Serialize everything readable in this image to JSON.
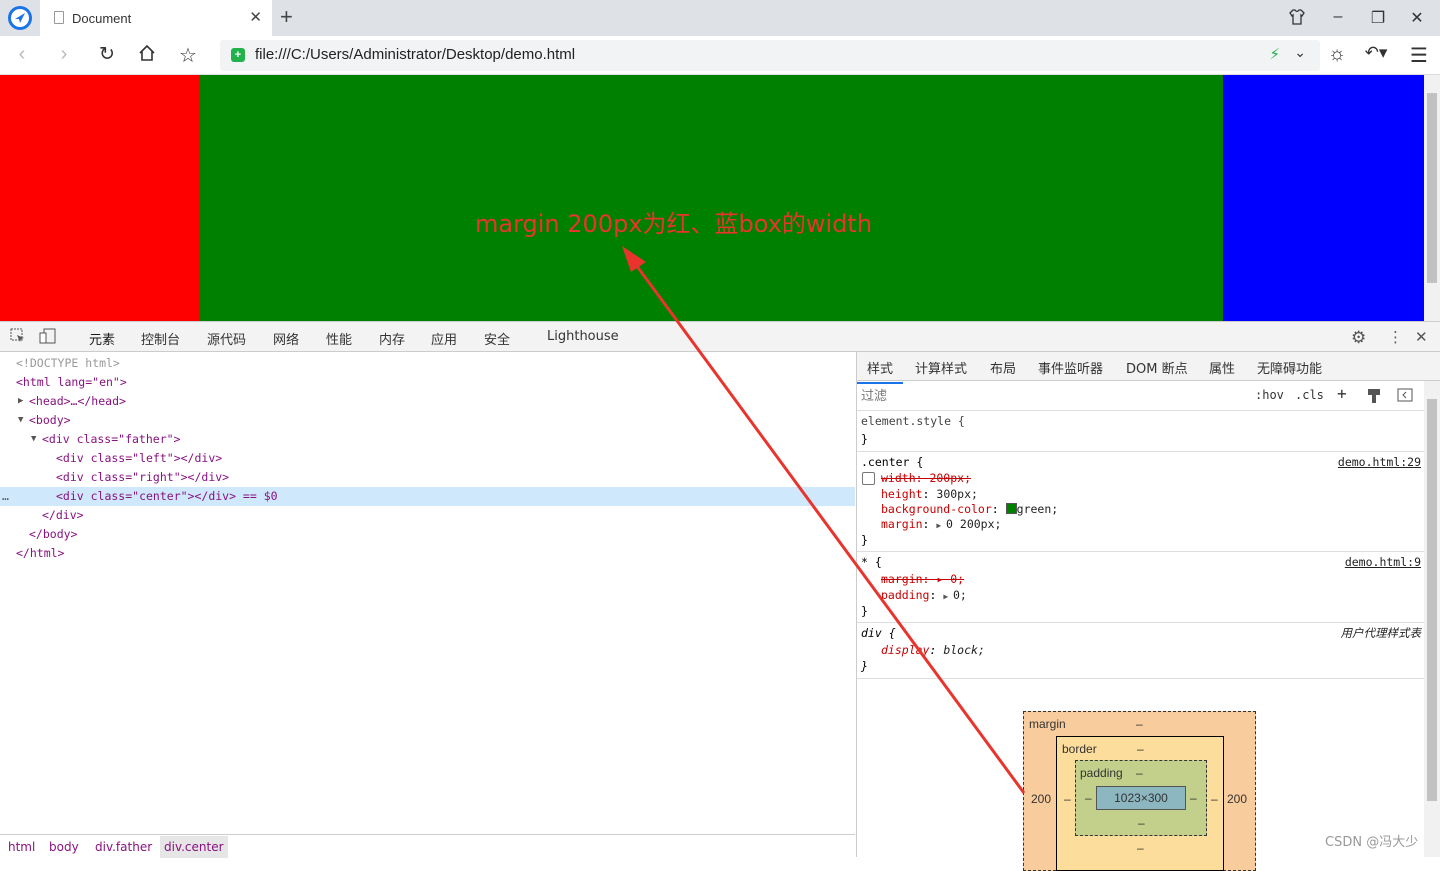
{
  "browser": {
    "tab_title": "Document",
    "tab_close": "✕",
    "new_tab": "+",
    "url": "file:///C:/Users/Administrator/Desktop/demo.html"
  },
  "page": {
    "annotation": "margin 200px为红、蓝box的width",
    "colors": {
      "left": "#ff0000",
      "center": "#008000",
      "right": "#0000ff",
      "annotation": "#e8342c"
    }
  },
  "devtools": {
    "tabs": [
      "元素",
      "控制台",
      "源代码",
      "网络",
      "性能",
      "内存",
      "应用",
      "安全",
      "Lighthouse"
    ],
    "active_tab": "元素",
    "dom": [
      {
        "text": "<!DOCTYPE html>"
      },
      {
        "text": "<html lang=\"en\">"
      },
      {
        "text": "<head>…</head>"
      },
      {
        "text": "<body>"
      },
      {
        "text": "<div class=\"father\">"
      },
      {
        "text": "<div class=\"left\"></div>"
      },
      {
        "text": "<div class=\"right\"></div>"
      },
      {
        "text": "<div class=\"center\"></div> == $0"
      },
      {
        "text": "</div>"
      },
      {
        "text": "</body>"
      },
      {
        "text": "</html>"
      }
    ],
    "breadcrumbs": [
      "html",
      "body",
      "div.father",
      "div.center"
    ],
    "styles_tabs": [
      "样式",
      "计算样式",
      "布局",
      "事件监听器",
      "DOM 断点",
      "属性",
      "无障碍功能"
    ],
    "filter_placeholder": "过滤",
    "hov": ":hov",
    "cls": ".cls",
    "rules": {
      "element_style": "element.style {",
      "close": "}",
      "center_selector": ".center {",
      "center_source": "demo.html:29",
      "center_width": "width: 200px;",
      "center_height_prop": "height",
      "center_height_val": "300px;",
      "center_bg_prop": "background-color",
      "center_bg_val": "green;",
      "center_margin_prop": "margin",
      "center_margin_val": "0 200px;",
      "star_selector": "* {",
      "star_source": "demo.html:9",
      "star_margin": "margin: ▸ 0;",
      "star_padding_prop": "padding",
      "star_padding_val": "0;",
      "div_selector": "div {",
      "div_source": "用户代理样式表",
      "div_display_prop": "display",
      "div_display_val": "block;"
    },
    "box_model": {
      "margin_label": "margin",
      "border_label": "border",
      "padding_label": "padding",
      "dash": "–",
      "content": "1023×300",
      "margin_left": "200",
      "margin_right": "200"
    }
  },
  "watermark": "CSDN @冯大少"
}
